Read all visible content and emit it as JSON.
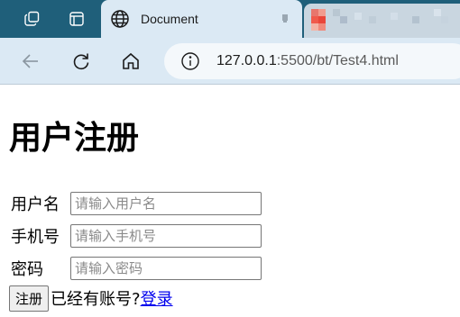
{
  "browser": {
    "active_tab_title": "Document",
    "url_host": "127.0.0.1",
    "url_rest": ":5500/bt/Test4.html"
  },
  "page": {
    "heading": "用户注册",
    "fields": [
      {
        "label": "用户名",
        "placeholder": "请输入用户名"
      },
      {
        "label": "手机号",
        "placeholder": "请输入手机号"
      },
      {
        "label": "密码",
        "placeholder": "请输入密码"
      }
    ],
    "submit_label": "注册",
    "have_account_text": "已经有账号?",
    "login_link_text": "登录"
  },
  "icons": {
    "workspaces": "workspaces-icon",
    "tab_actions": "tab-actions-icon",
    "site": "globe-icon",
    "close": "close-icon",
    "back": "back-arrow-icon",
    "refresh": "refresh-icon",
    "home": "home-icon",
    "info": "info-icon"
  },
  "colors": {
    "tabstrip": "#1f5f7a",
    "toolbar": "#dbe9f4",
    "link": "#0000ee"
  }
}
